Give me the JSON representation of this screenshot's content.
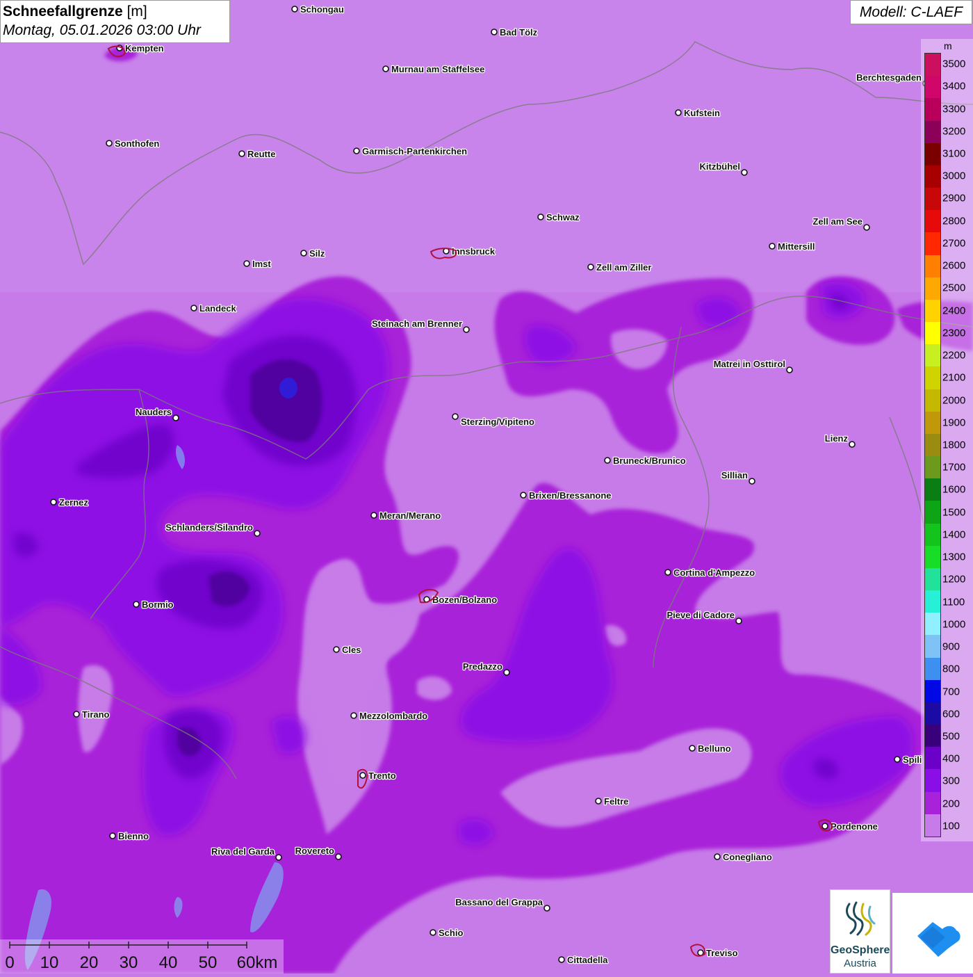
{
  "header": {
    "title": "Schneefallgrenze",
    "unit": "[m]",
    "datetime": "Montag, 05.01.2026 03:00 Uhr",
    "model": "Modell: C-LAEF"
  },
  "legend": {
    "unit": "m",
    "levels": [
      {
        "label": "100",
        "color": "#c77be8"
      },
      {
        "label": "200",
        "color": "#a822d9"
      },
      {
        "label": "300",
        "color": "#8a0fe6"
      },
      {
        "label": "400",
        "color": "#6b00c8"
      },
      {
        "label": "500",
        "color": "#38007a"
      },
      {
        "label": "600",
        "color": "#1b0aa3"
      },
      {
        "label": "700",
        "color": "#0008e6"
      },
      {
        "label": "800",
        "color": "#3d8ff0"
      },
      {
        "label": "900",
        "color": "#7fc2f5"
      },
      {
        "label": "1000",
        "color": "#90f0ff"
      },
      {
        "label": "1100",
        "color": "#26f0d6"
      },
      {
        "label": "1200",
        "color": "#20e29a"
      },
      {
        "label": "1300",
        "color": "#18dd28"
      },
      {
        "label": "1400",
        "color": "#12c41c"
      },
      {
        "label": "1500",
        "color": "#0da516"
      },
      {
        "label": "1600",
        "color": "#0a7e12"
      },
      {
        "label": "1700",
        "color": "#6c9a1c"
      },
      {
        "label": "1800",
        "color": "#9a8c10"
      },
      {
        "label": "1900",
        "color": "#c0980a"
      },
      {
        "label": "2000",
        "color": "#c4b800"
      },
      {
        "label": "2100",
        "color": "#cfd400"
      },
      {
        "label": "2200",
        "color": "#c8f020"
      },
      {
        "label": "2300",
        "color": "#ffff00"
      },
      {
        "label": "2400",
        "color": "#ffd200"
      },
      {
        "label": "2500",
        "color": "#ffa800"
      },
      {
        "label": "2600",
        "color": "#ff8000"
      },
      {
        "label": "2700",
        "color": "#ff2800"
      },
      {
        "label": "2800",
        "color": "#e60a0a"
      },
      {
        "label": "2900",
        "color": "#c80808"
      },
      {
        "label": "3000",
        "color": "#a80000"
      },
      {
        "label": "3100",
        "color": "#7a0000"
      },
      {
        "label": "3200",
        "color": "#8c005a"
      },
      {
        "label": "3300",
        "color": "#b8005a"
      },
      {
        "label": "3400",
        "color": "#d0066a"
      },
      {
        "label": "3500",
        "color": "#cc0f5e"
      }
    ]
  },
  "scale": {
    "labels": [
      "0",
      "10",
      "20",
      "30",
      "40",
      "50",
      "60km"
    ]
  },
  "cities": [
    {
      "name": "Schongau"
    },
    {
      "name": "Bad Tölz"
    },
    {
      "name": "Kempten"
    },
    {
      "name": "Murnau am Staffelsee"
    },
    {
      "name": "Berchtesgaden"
    },
    {
      "name": "Kufstein"
    },
    {
      "name": "Sonthofen"
    },
    {
      "name": "Reutte"
    },
    {
      "name": "Garmisch-Partenkirchen"
    },
    {
      "name": "Kitzbühel"
    },
    {
      "name": "Schwaz"
    },
    {
      "name": "Zell am See"
    },
    {
      "name": "Mittersill"
    },
    {
      "name": "Innsbruck"
    },
    {
      "name": "Silz"
    },
    {
      "name": "Imst"
    },
    {
      "name": "Zell am Ziller"
    },
    {
      "name": "Landeck"
    },
    {
      "name": "Steinach am Brenner"
    },
    {
      "name": "Matrei in Osttirol"
    },
    {
      "name": "Nauders"
    },
    {
      "name": "Sterzing/Vipiteno"
    },
    {
      "name": "Lienz"
    },
    {
      "name": "Bruneck/Brunico"
    },
    {
      "name": "Sillian"
    },
    {
      "name": "Zernez"
    },
    {
      "name": "Brixen/Bressanone"
    },
    {
      "name": "Meran/Merano"
    },
    {
      "name": "Schlanders/Silandro"
    },
    {
      "name": "Cortina d'Ampezzo"
    },
    {
      "name": "Bormio"
    },
    {
      "name": "Bozen/Bolzano"
    },
    {
      "name": "Pieve di Cadore"
    },
    {
      "name": "Cles"
    },
    {
      "name": "Predazzo"
    },
    {
      "name": "Tirano"
    },
    {
      "name": "Mezzolombardo"
    },
    {
      "name": "Belluno"
    },
    {
      "name": "Spili"
    },
    {
      "name": "Trento"
    },
    {
      "name": "Feltre"
    },
    {
      "name": "Pordenone"
    },
    {
      "name": "Bienno"
    },
    {
      "name": "Riva del Garda"
    },
    {
      "name": "Rovereto"
    },
    {
      "name": "Conegliano"
    },
    {
      "name": "Bassano del Grappa"
    },
    {
      "name": "Schio"
    },
    {
      "name": "Treviso"
    },
    {
      "name": "Cittadella"
    }
  ],
  "logos": {
    "geosphere_name": "GeoSphere",
    "geosphere_sub": "Austria",
    "geosphere-icon": "geosphere-logo-icon",
    "app-icon": "app-logo-icon"
  }
}
